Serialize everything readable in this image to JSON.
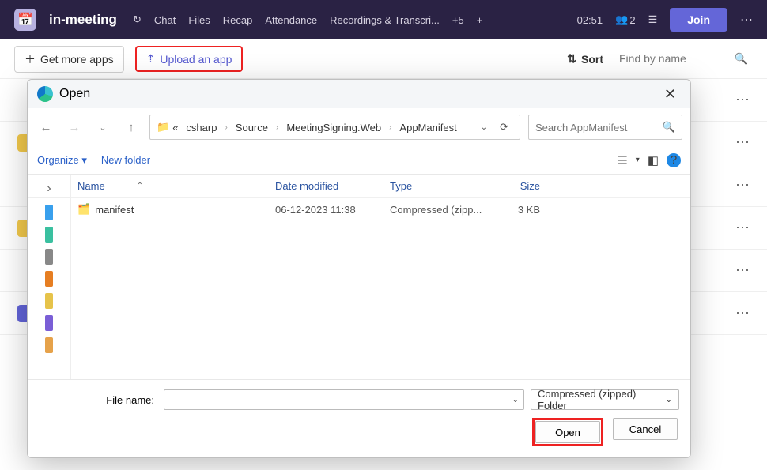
{
  "header": {
    "title": "in-meeting",
    "tabs": [
      "Chat",
      "Files",
      "Recap",
      "Attendance",
      "Recordings & Transcri..."
    ],
    "more_tabs": "+5",
    "add_tab": "+",
    "clock": "02:51",
    "people_count": "2",
    "join_label": "Join"
  },
  "actionbar": {
    "get_more_apps": "Get more apps",
    "upload_app": "Upload an app",
    "sort_label": "Sort",
    "search_placeholder": "Find by name"
  },
  "dialog": {
    "title": "Open",
    "breadcrumbs_prefix": "«",
    "breadcrumbs": [
      "csharp",
      "Source",
      "MeetingSigning.Web",
      "AppManifest"
    ],
    "search_placeholder": "Search AppManifest",
    "organize": "Organize ▾",
    "new_folder": "New folder",
    "columns": {
      "name": "Name",
      "date": "Date modified",
      "type": "Type",
      "size": "Size"
    },
    "files": [
      {
        "name": "manifest",
        "date": "06-12-2023 11:38",
        "type": "Compressed (zipp...",
        "size": "3 KB"
      }
    ],
    "file_name_label": "File name:",
    "file_type": "Compressed (zipped) Folder",
    "open_label": "Open",
    "cancel_label": "Cancel"
  }
}
